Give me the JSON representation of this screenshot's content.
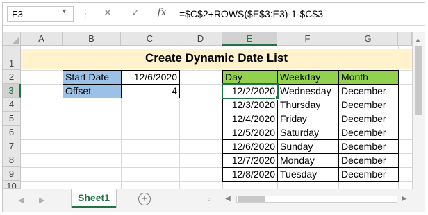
{
  "formula_bar": {
    "name_box": "E3",
    "cancel_glyph": "✕",
    "enter_glyph": "✓",
    "fx_label": "fx",
    "formula": "=$C$2+ROWS($E$3:E3)-1-$C$3"
  },
  "columns": [
    "A",
    "B",
    "C",
    "D",
    "E",
    "F",
    "G"
  ],
  "rows": [
    "1",
    "2",
    "3",
    "4",
    "5",
    "6",
    "7",
    "8",
    "9",
    "10"
  ],
  "selected_column": "E",
  "selected_row": "3",
  "title": "Create Dynamic Date List",
  "inputs": {
    "start_label": "Start Date",
    "start_value": "12/6/2020",
    "offset_label": "Offset",
    "offset_value": "4"
  },
  "table": {
    "headers": [
      "Day",
      "Weekday",
      "Month"
    ],
    "rows": [
      [
        "12/2/2020",
        "Wednesday",
        "December"
      ],
      [
        "12/3/2020",
        "Thursday",
        "December"
      ],
      [
        "12/4/2020",
        "Friday",
        "December"
      ],
      [
        "12/5/2020",
        "Saturday",
        "December"
      ],
      [
        "12/6/2020",
        "Sunday",
        "December"
      ],
      [
        "12/7/2020",
        "Monday",
        "December"
      ],
      [
        "12/8/2020",
        "Tuesday",
        "December"
      ]
    ]
  },
  "sheet_tab": "Sheet1",
  "add_sheet_glyph": "+",
  "colors": {
    "title_fill": "#fff2cc",
    "input_label_fill": "#9bc2e6",
    "header_fill": "#92d050",
    "accent": "#217346"
  },
  "icons": [
    "name-box-dropdown-icon",
    "cancel-icon",
    "enter-icon",
    "insert-function-icon",
    "add-sheet-icon",
    "scroll-arrow-icon"
  ]
}
